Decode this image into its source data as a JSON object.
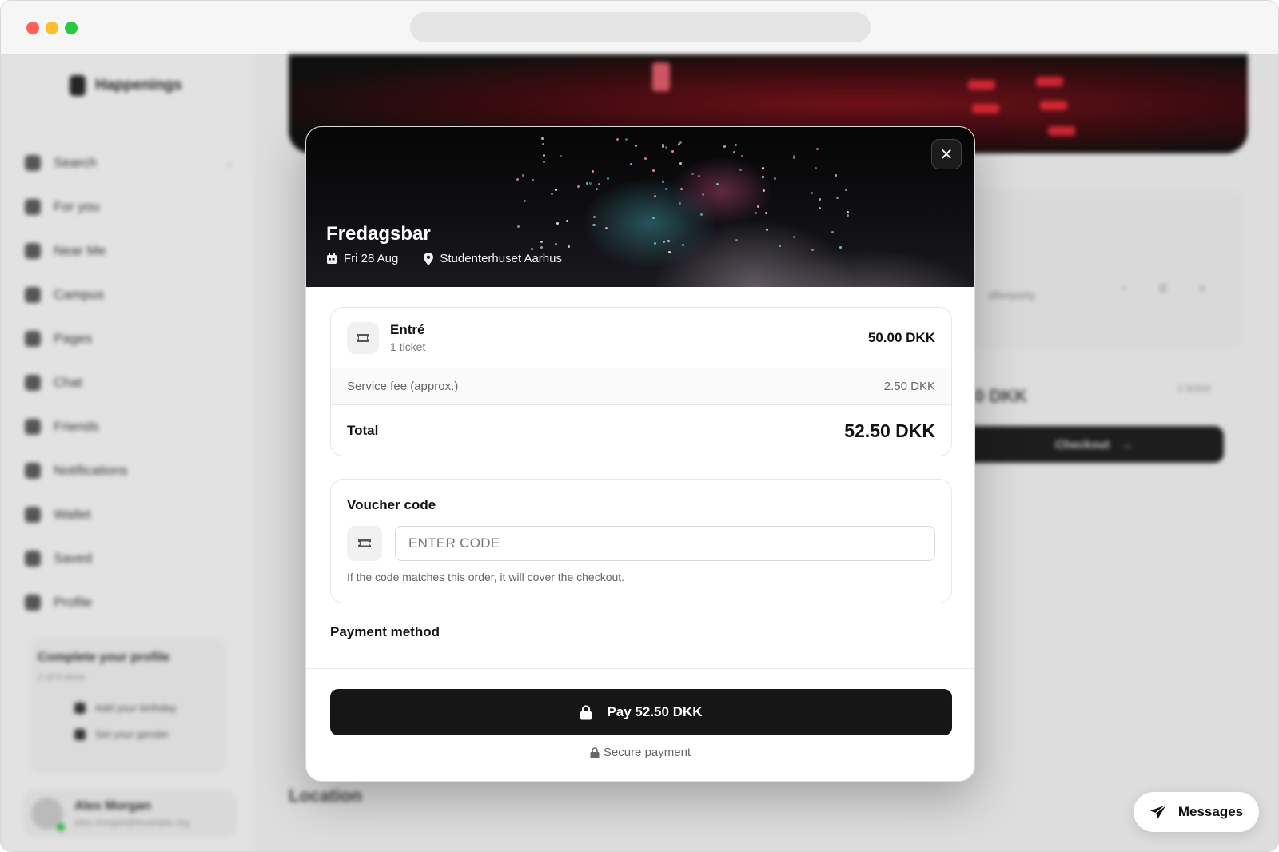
{
  "background_app": {
    "brand": "Happenings",
    "sidebar": [
      {
        "label": "Search",
        "icon": "search-icon"
      },
      {
        "label": "For you",
        "icon": "home-icon"
      },
      {
        "label": "Near Me",
        "icon": "pin-icon"
      },
      {
        "label": "Campus",
        "icon": "campus-icon"
      },
      {
        "label": "Pages",
        "icon": "pages-icon"
      },
      {
        "label": "Chat",
        "icon": "chat-icon"
      },
      {
        "label": "Friends",
        "icon": "friends-icon"
      },
      {
        "label": "Notifications",
        "icon": "bell-icon"
      },
      {
        "label": "Wallet",
        "icon": "wallet-icon"
      },
      {
        "label": "Saved",
        "icon": "bookmark-icon"
      },
      {
        "label": "Profile",
        "icon": "user-icon"
      }
    ],
    "profile_card": {
      "title": "Complete your profile",
      "subtitle": "2 of 6 done",
      "tasks": [
        "Add your birthday",
        "Set your gender"
      ]
    },
    "user": {
      "name": "Alex Morgan",
      "email": "alex.morgan@example.org"
    },
    "right_panel": {
      "label": "afterparty",
      "quantity": "0",
      "amount": "0 DKK",
      "count": "1 ticket",
      "checkout": "Checkout"
    },
    "section_heading": "Location"
  },
  "modal": {
    "event_title": "Fredagsbar",
    "date": "Fri 28 Aug",
    "venue": "Studenterhuset Aarhus",
    "close_symbol": "✕",
    "summary": {
      "ticket_name": "Entré",
      "ticket_qty": "1 ticket",
      "ticket_price": "50.00 DKK",
      "fee_label": "Service fee (approx.)",
      "fee_value": "2.50 DKK",
      "total_label": "Total",
      "total_value": "52.50 DKK"
    },
    "voucher": {
      "title": "Voucher code",
      "placeholder": "ENTER CODE",
      "hint": "If the code matches this order, it will cover the checkout."
    },
    "payment_label": "Payment method",
    "pay_button": "Pay 52.50 DKK",
    "secure_note": "Secure payment"
  },
  "messages_button": "Messages",
  "colors": {
    "primary_button": "#161616",
    "traffic_red": "#fe5f57",
    "traffic_yellow": "#febc2e",
    "traffic_green": "#28c840"
  }
}
